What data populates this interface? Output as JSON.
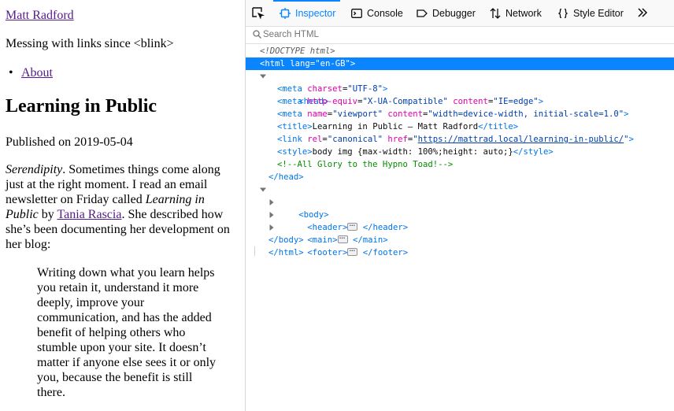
{
  "page": {
    "site_title": "Matt Radford",
    "tagline": "Messing with links since <blink>",
    "nav_items": [
      "About"
    ],
    "post_title": "Learning in Public",
    "published": "Published on 2019-05-04",
    "intro_em": "Serendipity",
    "intro_1": ". Sometimes things come along just at the right moment. I read an email newsletter on Friday called ",
    "intro_em2": "Learning in Public",
    "intro_2": " by ",
    "intro_link": "Tania Rascia",
    "intro_3": ". She described how she’s been documenting her development on her blog:",
    "quote": "Writing down what you learn helps you retain it, understand it more deeply, improve your communication, and has the added benefit of helping others who stumble upon your site. It doesn’t matter if anyone else sees it or only you, because the benefit is still there."
  },
  "devtools": {
    "tabs": [
      "Inspector",
      "Console",
      "Debugger",
      "Network",
      "Style Editor"
    ],
    "active_tab": "Inspector",
    "search_placeholder": "Search HTML",
    "colors": {
      "accent": "#0a84ff",
      "tag": "#0074e8",
      "attr": "#dd00a9",
      "value": "#003eaa",
      "comment": "#058b00"
    },
    "tree": {
      "doctype": "<!DOCTYPE html>",
      "html_open_tag": "html",
      "html_lang_attr": "lang",
      "html_lang_val": "\"en-GB\"",
      "head_tag": "head",
      "meta1": {
        "attr": "charset",
        "val": "\"UTF-8\""
      },
      "meta2": {
        "attr1": "http-equiv",
        "val1": "\"X-UA-Compatible\"",
        "attr2": "content",
        "val2": "\"IE=edge\""
      },
      "meta3": {
        "attr1": "name",
        "val1": "\"viewport\"",
        "attr2": "content",
        "val2": "\"width=device-width, initial-scale=1.0\""
      },
      "title_text": "Learning in Public – Matt Radford",
      "link": {
        "attr1": "rel",
        "val1": "\"canonical\"",
        "attr2": "href",
        "url": "https://mattrad.local/learning-in-public/"
      },
      "style_text": "body img {max-width: 100%;height: auto;}",
      "comment": "<!--All Glory to the Hypno Toad!-->",
      "body_tag": "body",
      "children": [
        "header",
        "main",
        "footer"
      ]
    }
  }
}
